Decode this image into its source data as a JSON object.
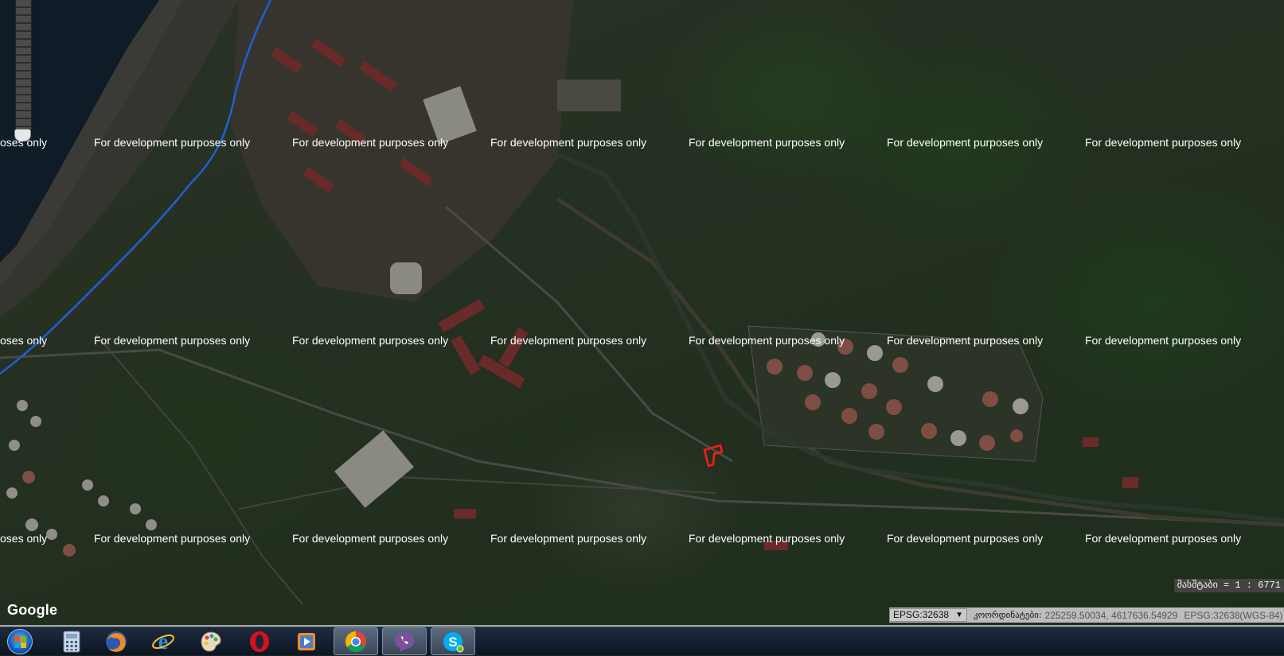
{
  "map": {
    "watermark_text": "For development purposes only",
    "watermark_partial": "oses only",
    "provider_logo": "Google",
    "scale_text": "მასშტაბი = 1 : 6771",
    "route_color": "#1f5fd8",
    "highlight_color": "#ff1a1a"
  },
  "info_bar": {
    "crs_selected": "EPSG:32638",
    "coordinates_label": "კოორდინატები:",
    "coordinates_value": "225259.50034, 4617636.54929",
    "crs_note": "EPSG:32638(WGS-84)"
  },
  "taskbar": {
    "items": [
      {
        "name": "start-button",
        "icon": "windows-orb-icon"
      },
      {
        "name": "calculator",
        "icon": "calculator-icon"
      },
      {
        "name": "firefox",
        "icon": "firefox-icon"
      },
      {
        "name": "internet-explorer",
        "icon": "internet-explorer-icon"
      },
      {
        "name": "paint",
        "icon": "paint-palette-icon"
      },
      {
        "name": "opera",
        "icon": "opera-icon"
      },
      {
        "name": "media-player",
        "icon": "media-player-icon"
      },
      {
        "name": "chrome",
        "icon": "chrome-icon",
        "active": true
      },
      {
        "name": "viber",
        "icon": "viber-icon",
        "active": true
      },
      {
        "name": "skype",
        "icon": "skype-icon",
        "active": true
      }
    ]
  }
}
